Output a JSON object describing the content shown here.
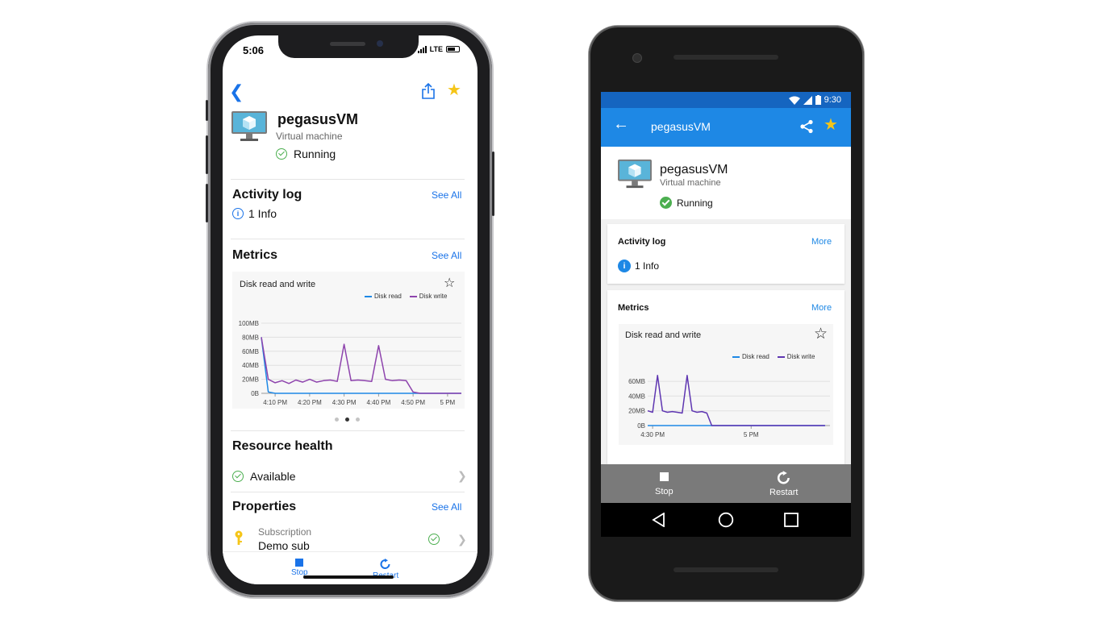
{
  "ios": {
    "time": "5:06",
    "network": "LTE",
    "vm_name": "pegasusVM",
    "vm_type": "Virtual machine",
    "status": "Running",
    "activity_log": {
      "title": "Activity log",
      "link": "See All",
      "info": "1 Info"
    },
    "metrics": {
      "title": "Metrics",
      "link": "See All",
      "chart_title": "Disk read and write",
      "legend": [
        "Disk read",
        "Disk write"
      ],
      "y_ticks": [
        "100MB",
        "80MB",
        "60MB",
        "40MB",
        "20MB",
        "0B"
      ],
      "x_ticks": [
        "4:10 PM",
        "4:20 PM",
        "4:30 PM",
        "4:40 PM",
        "4:50 PM",
        "5 PM"
      ]
    },
    "resource_health": {
      "title": "Resource health",
      "value": "Available"
    },
    "properties": {
      "title": "Properties",
      "link": "See All",
      "label": "Subscription",
      "value": "Demo sub"
    },
    "toolbar": {
      "stop": "Stop",
      "restart": "Restart"
    }
  },
  "android": {
    "time": "9:30",
    "title": "pegasusVM",
    "vm_name": "pegasusVM",
    "vm_type": "Virtual machine",
    "status": "Running",
    "activity_log": {
      "title": "Activity log",
      "link": "More",
      "info": "1 Info"
    },
    "metrics": {
      "title": "Metrics",
      "link": "More",
      "chart_title": "Disk read and write",
      "legend": [
        "Disk read",
        "Disk write"
      ],
      "y_ticks": [
        "60MB",
        "40MB",
        "20MB",
        "0B"
      ],
      "x_ticks": [
        "4:30 PM",
        "5 PM"
      ]
    },
    "toolbar": {
      "stop": "Stop",
      "restart": "Restart"
    }
  },
  "colors": {
    "accent": "#1a73e8",
    "android_appbar": "#1e88e5",
    "disk_read": "#1e88e5",
    "disk_write": "#8e44ad",
    "success": "#4caf50",
    "favorite": "#f5c518"
  },
  "chart_data": [
    {
      "type": "line",
      "chart": "ios",
      "title": "Disk read and write",
      "x": [
        "4:06 PM",
        "4:08 PM",
        "4:10 PM",
        "4:12 PM",
        "4:14 PM",
        "4:16 PM",
        "4:18 PM",
        "4:20 PM",
        "4:22 PM",
        "4:24 PM",
        "4:26 PM",
        "4:28 PM",
        "4:30 PM",
        "4:32 PM",
        "4:34 PM",
        "4:36 PM",
        "4:38 PM",
        "4:40 PM",
        "4:42 PM",
        "4:44 PM",
        "4:46 PM",
        "4:48 PM",
        "4:50 PM",
        "4:52 PM",
        "4:56 PM",
        "5:00 PM",
        "5:04 PM"
      ],
      "x_minutes": [
        6,
        8,
        10,
        12,
        14,
        16,
        18,
        20,
        22,
        24,
        26,
        28,
        30,
        32,
        34,
        36,
        38,
        40,
        42,
        44,
        46,
        48,
        50,
        52,
        56,
        60,
        64
      ],
      "series": [
        {
          "name": "Disk read",
          "values": [
            80,
            2,
            0,
            0,
            0,
            0,
            0,
            0,
            0,
            0,
            0,
            0,
            0,
            0,
            0,
            0,
            0,
            0,
            0,
            0,
            0,
            0,
            0,
            0,
            0,
            0,
            0
          ]
        },
        {
          "name": "Disk write",
          "values": [
            80,
            20,
            15,
            18,
            14,
            19,
            16,
            20,
            16,
            18,
            19,
            17,
            70,
            18,
            19,
            18,
            17,
            68,
            20,
            18,
            19,
            18,
            2,
            0,
            0,
            0,
            0
          ]
        }
      ],
      "ylim": [
        0,
        100
      ],
      "y_unit": "MB",
      "grid": true,
      "legend": "top-right"
    },
    {
      "type": "line",
      "chart": "android",
      "title": "Disk read and write",
      "x_minutes": [
        29,
        30,
        31,
        32,
        33,
        34,
        35,
        36,
        37,
        38,
        39,
        40,
        41,
        42,
        45,
        50,
        55,
        60,
        65
      ],
      "series": [
        {
          "name": "Disk read",
          "values": [
            0,
            0,
            0,
            0,
            0,
            0,
            0,
            0,
            0,
            0,
            0,
            0,
            0,
            0,
            0,
            0,
            0,
            0,
            0
          ]
        },
        {
          "name": "Disk write",
          "values": [
            20,
            18,
            68,
            20,
            18,
            19,
            18,
            17,
            68,
            20,
            18,
            19,
            17,
            0,
            0,
            0,
            0,
            0,
            0
          ]
        }
      ],
      "ylim": [
        0,
        70
      ],
      "y_unit": "MB",
      "grid": true,
      "legend": "top-right"
    }
  ]
}
